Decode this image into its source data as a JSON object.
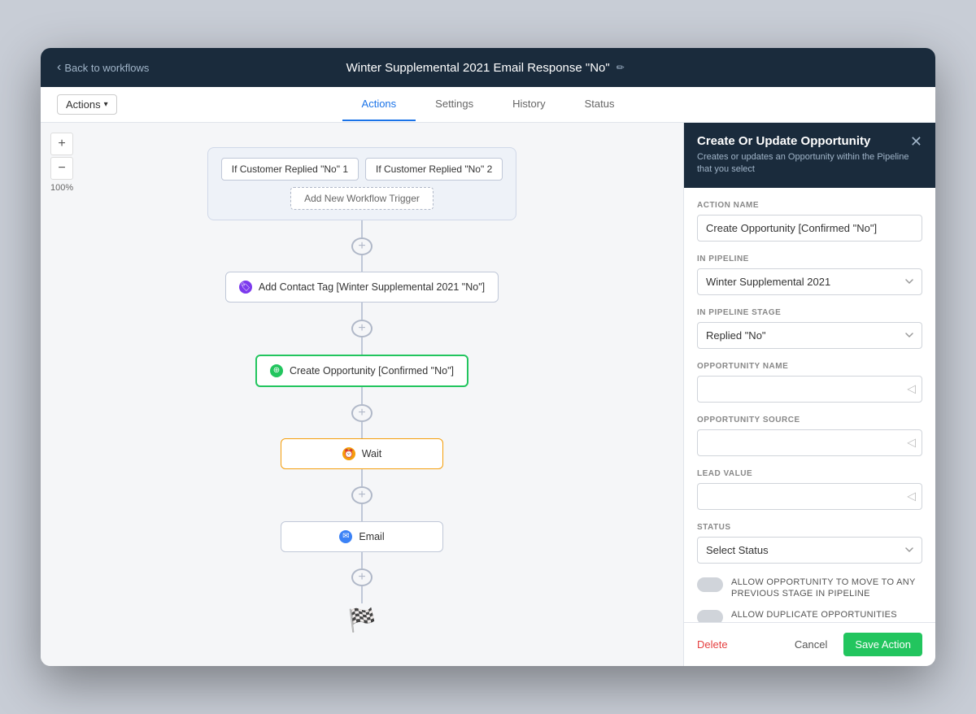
{
  "topBar": {
    "backLabel": "Back to workflows",
    "workflowTitle": "Winter Supplemental 2021 Email Response \"No\"",
    "editIcon": "✏"
  },
  "tabs": {
    "actionsLabel": "Actions",
    "actionsDropdown": "Actions",
    "tabList": [
      "Actions",
      "Settings",
      "History",
      "Status"
    ],
    "activeTab": "Actions"
  },
  "canvas": {
    "zoomLevel": "100%",
    "plusBtn": "+",
    "minusBtn": "−",
    "triggers": [
      "If Customer Replied \"No\" 1",
      "If Customer Replied \"No\" 2"
    ],
    "addTriggerLabel": "Add New Workflow Trigger",
    "nodes": [
      {
        "type": "tag",
        "label": "Add Contact Tag [Winter Supplemental 2021 \"No\"]",
        "iconType": "purple",
        "iconSymbol": "🏷"
      },
      {
        "type": "opportunity",
        "label": "Create Opportunity [Confirmed \"No\"]",
        "iconType": "green",
        "iconSymbol": "⊕"
      },
      {
        "type": "wait",
        "label": "Wait",
        "iconType": "orange",
        "iconSymbol": "⏰"
      },
      {
        "type": "email",
        "label": "Email",
        "iconType": "blue",
        "iconSymbol": "✉"
      }
    ],
    "finishFlag": "🏁"
  },
  "rightPanel": {
    "title": "Create Or Update Opportunity",
    "subtitle": "Creates or updates an Opportunity within the Pipeline that you select",
    "fields": {
      "actionNameLabel": "Action Name",
      "actionNameValue": "Create Opportunity [Confirmed \"No\"]",
      "inPipelineLabel": "In Pipeline",
      "inPipelineValue": "Winter Supplemental 2021",
      "inPipelineStageLabel": "In Pipeline Stage",
      "inPipelineStageValue": "Replied \"No\"",
      "opportunityNameLabel": "Opportunity Name",
      "opportunityNameValue": "",
      "opportunitySourceLabel": "Opportunity Source",
      "opportunitySourceValue": "",
      "leadValueLabel": "Lead Value",
      "leadValueValue": "",
      "statusLabel": "Status",
      "statusValue": "Select Status",
      "allowMoveLabel": "Allow Opportunity To Move To Any Previous Stage In Pipeline",
      "allowDuplicateLabel": "Allow Duplicate Opportunities"
    },
    "footer": {
      "deleteLabel": "Delete",
      "cancelLabel": "Cancel",
      "saveLabel": "Save Action"
    }
  }
}
